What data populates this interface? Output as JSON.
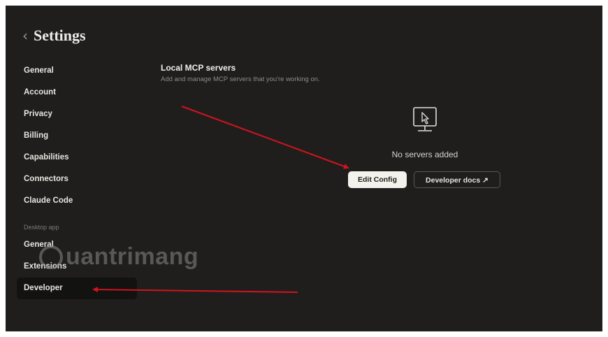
{
  "header": {
    "back_icon": "chevron-left-icon",
    "title": "Settings"
  },
  "sidebar": {
    "items": [
      {
        "label": "General"
      },
      {
        "label": "Account"
      },
      {
        "label": "Privacy"
      },
      {
        "label": "Billing"
      },
      {
        "label": "Capabilities"
      },
      {
        "label": "Connectors"
      },
      {
        "label": "Claude Code"
      }
    ],
    "section_label": "Desktop app",
    "desktop_items": [
      {
        "label": "General"
      },
      {
        "label": "Extensions"
      },
      {
        "label": "Developer",
        "active": true
      }
    ]
  },
  "panel": {
    "title": "Local MCP servers",
    "description": "Add and manage MCP servers that you're working on.",
    "empty_icon": "monitor-cursor-icon",
    "empty_text": "No servers added",
    "edit_config_label": "Edit Config",
    "developer_docs_label": "Developer docs ↗"
  },
  "watermark": {
    "text": "uantrimang"
  },
  "colors": {
    "background": "#1f1e1d",
    "arrow": "#d0141c",
    "primary_button": "#f4f2ec"
  }
}
